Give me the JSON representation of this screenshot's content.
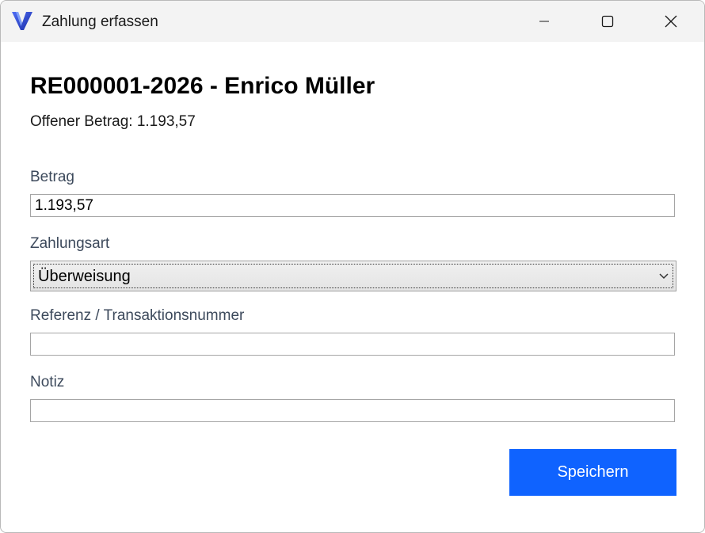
{
  "window": {
    "title": "Zahlung erfassen",
    "app_icon": "v-logo-icon",
    "controls": {
      "minimize": "minimize-icon",
      "maximize": "maximize-icon",
      "close": "close-icon"
    }
  },
  "header": {
    "title": "RE000001-2026 - Enrico Müller",
    "open_amount": "Offener Betrag: 1.193,57"
  },
  "form": {
    "amount": {
      "label": "Betrag",
      "value": "1.193,57"
    },
    "payment_method": {
      "label": "Zahlungsart",
      "value": "Überweisung"
    },
    "reference": {
      "label": "Referenz / Transaktionsnummer",
      "value": ""
    },
    "note": {
      "label": "Notiz",
      "value": ""
    }
  },
  "actions": {
    "save_label": "Speichern"
  },
  "colors": {
    "accent": "#0f63ff",
    "label": "#3d4a5c",
    "titlebar": "#f3f3f3"
  }
}
